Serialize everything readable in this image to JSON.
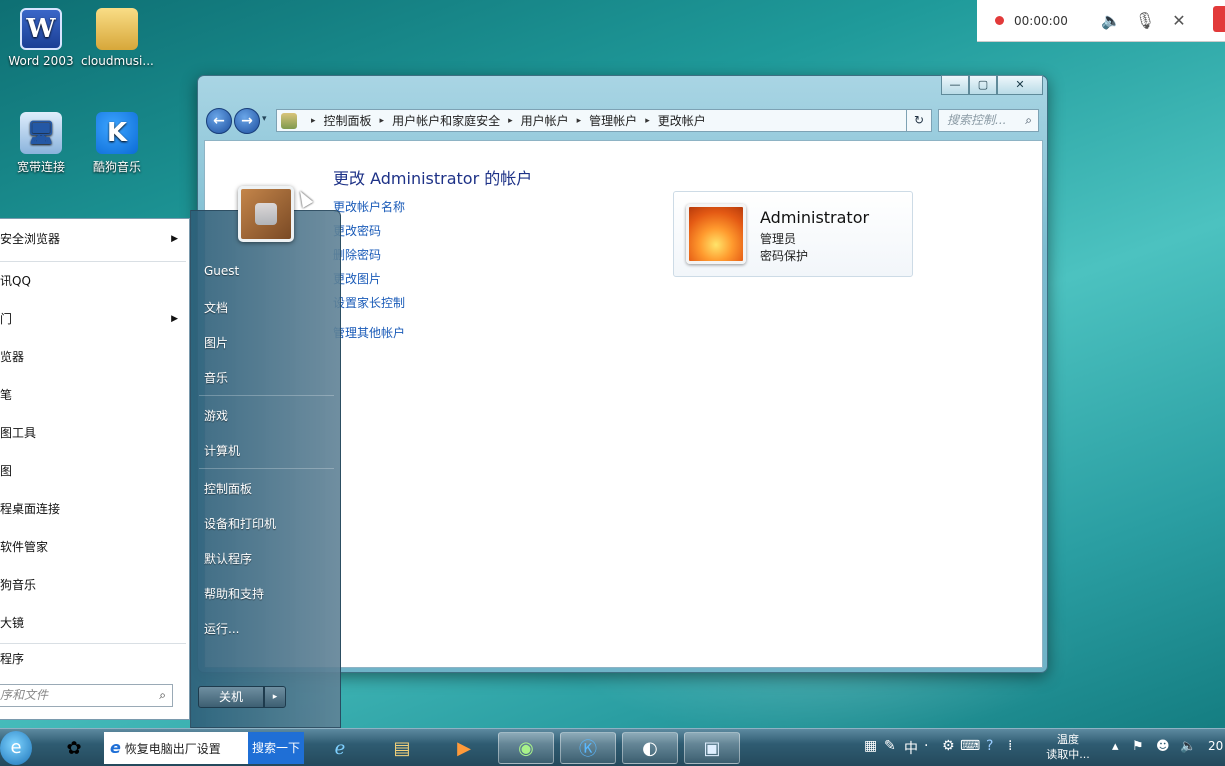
{
  "desktop": {
    "icons": [
      {
        "label": "Word 2003",
        "glyph": "W"
      },
      {
        "label": "cloudmusi...",
        "glyph": ""
      },
      {
        "label": "宽带连接",
        "glyph": "🖥"
      },
      {
        "label": "酷狗音乐",
        "glyph": "K"
      }
    ]
  },
  "recorder": {
    "time": "00:00:00",
    "volume_icon": "speaker-icon",
    "mic_icon": "mic-muted-icon",
    "close_icon": "close-icon"
  },
  "window": {
    "controls": {
      "minimize": "—",
      "maximize": "▢",
      "close": "✕"
    },
    "nav": {
      "back": "←",
      "forward": "→",
      "history_drop": "▾"
    },
    "breadcrumb": [
      "控制面板",
      "用户帐户和家庭安全",
      "用户帐户",
      "管理帐户",
      "更改帐户"
    ],
    "refresh": "↻",
    "search_placeholder": "搜索控制...",
    "page_title": "更改 Administrator 的帐户",
    "tasks": [
      "更改帐户名称",
      "更改密码",
      "删除密码",
      "更改图片",
      "设置家长控制",
      "管理其他帐户"
    ],
    "account": {
      "name": "Administrator",
      "role": "管理员",
      "status": "密码保护"
    }
  },
  "start_menu": {
    "left_items": [
      {
        "label": "安全浏览器",
        "has_arrow": true
      },
      {
        "label": "讯QQ",
        "has_arrow": false
      },
      {
        "label": "门",
        "has_arrow": true
      },
      {
        "label": "览器",
        "has_arrow": false
      },
      {
        "label": "笔",
        "has_arrow": false
      },
      {
        "label": "图工具",
        "has_arrow": false
      },
      {
        "label": "图",
        "has_arrow": false
      },
      {
        "label": "程桌面连接",
        "has_arrow": false
      },
      {
        "label": "软件管家",
        "has_arrow": false
      },
      {
        "label": "狗音乐",
        "has_arrow": false
      },
      {
        "label": "大镜",
        "has_arrow": false
      }
    ],
    "all_programs": "程序",
    "search_placeholder": "序和文件",
    "right_items": [
      "Guest",
      "文档",
      "图片",
      "音乐",
      "游戏",
      "计算机",
      "控制面板",
      "设备和打印机",
      "默认程序",
      "帮助和支持",
      "运行..."
    ],
    "shutdown": "关机",
    "shutdown_arrow": "▸"
  },
  "taskbar": {
    "ie_tab_text": "恢复电脑出厂设置",
    "ie_search": "搜索一下",
    "tray_text": "中",
    "weather_line1": "温度",
    "weather_line2": "读取中...",
    "clock": "20"
  }
}
